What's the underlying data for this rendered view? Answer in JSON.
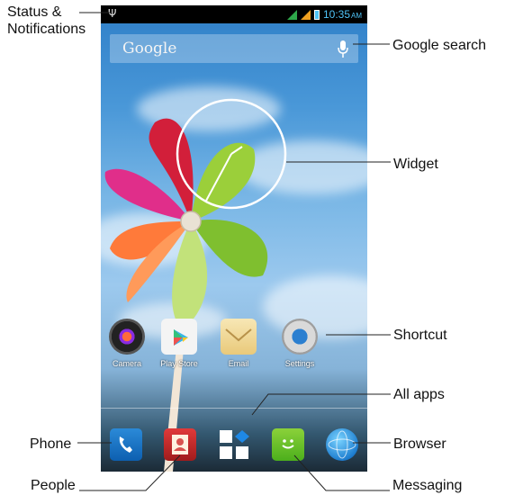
{
  "statusbar": {
    "time": "10:35",
    "ampm": "AM"
  },
  "search": {
    "text": "Google"
  },
  "apps": [
    {
      "label": "Camera"
    },
    {
      "label": "Play Store"
    },
    {
      "label": "Email"
    },
    {
      "label": "Settings"
    }
  ],
  "callouts": {
    "status": "Status &\nNotifications",
    "google_search": "Google search",
    "widget": "Widget",
    "shortcut": "Shortcut",
    "all_apps": "All apps",
    "phone": "Phone",
    "browser": "Browser",
    "people": "People",
    "messaging": "Messaging"
  },
  "colors": {
    "accent": "#4fc3f7",
    "signal_green": "#2ea84a",
    "signal_orange": "#f0a020"
  }
}
